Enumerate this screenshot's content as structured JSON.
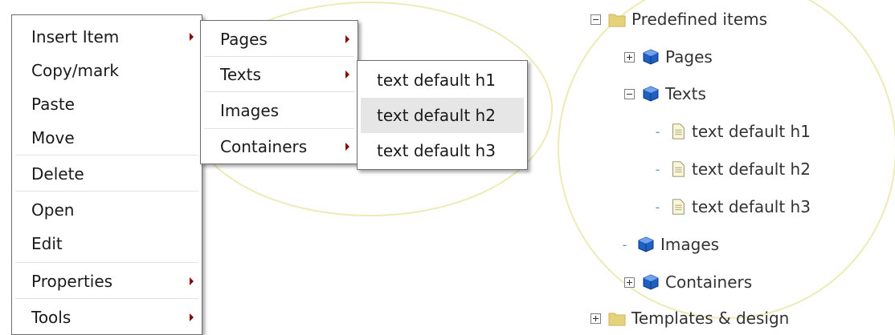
{
  "context_menu": {
    "items": [
      {
        "label": "Insert Item",
        "submenu": true
      },
      {
        "label": "Copy/mark",
        "submenu": false
      },
      {
        "label": "Paste",
        "submenu": false
      },
      {
        "label": "Move",
        "submenu": false
      },
      {
        "label": "Delete",
        "submenu": false
      },
      {
        "label": "Open",
        "submenu": false
      },
      {
        "label": "Edit",
        "submenu": false
      },
      {
        "label": "Properties",
        "submenu": true
      },
      {
        "label": "Tools",
        "submenu": true
      }
    ]
  },
  "insert_submenu": {
    "items": [
      {
        "label": "Pages",
        "submenu": true
      },
      {
        "label": "Texts",
        "submenu": true
      },
      {
        "label": "Images",
        "submenu": false
      },
      {
        "label": "Containers",
        "submenu": true
      }
    ]
  },
  "texts_submenu": {
    "items": [
      {
        "label": "text default h1",
        "highlighted": false
      },
      {
        "label": "text default h2",
        "highlighted": true
      },
      {
        "label": "text default h3",
        "highlighted": false
      }
    ]
  },
  "tree": {
    "root": {
      "label": "Predefined items",
      "expanded": true
    },
    "pages": {
      "label": "Pages",
      "expanded": false
    },
    "texts": {
      "label": "Texts",
      "expanded": true
    },
    "text_items": [
      "text default h1",
      "text default h2",
      "text default h3"
    ],
    "images": {
      "label": "Images"
    },
    "containers": {
      "label": "Containers",
      "expanded": false
    },
    "templates": {
      "label": "Templates & design",
      "expanded": false
    }
  },
  "colors": {
    "highlight": "#e6e6e6",
    "submenu_arrow": "#8b0000",
    "ellipse": "#ecebb6",
    "folder": "#e6d27a",
    "cube": "#1f5fbf"
  }
}
